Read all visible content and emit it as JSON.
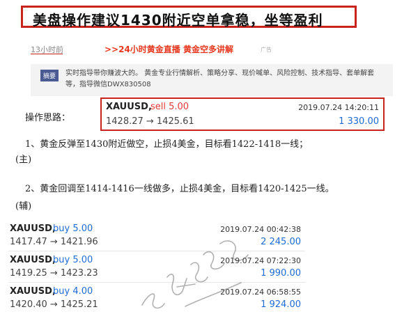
{
  "headline": "美盘操作建议1430附近空单拿稳，坐等盈利",
  "meta": {
    "time_ago": "13小时前",
    "promo_link": ">>24小时黄金直播 黄金空多讲解",
    "ad_tag": "广告"
  },
  "summary": {
    "badge": "摘要",
    "text": "实时指导带你赚波大的。 黄金专业行情解析、策略分享、现价喊单、风险控制、技术指导、套单解套等，指导微信DWX830508"
  },
  "strategy": {
    "title": "操作思路：",
    "item1_line1": "1、黄金反弹至1430附近做空，止损4美金，目标看1422-1418一线；",
    "item1_line2": "(主)",
    "item2_line1": "2、黄金回调至1414-1416一线做多，止损4美金，目标看1420-1425一线。",
    "item2_line2": "(辅)"
  },
  "main_trade": {
    "symbol": "XAUUSD,",
    "side": "sell 5.00",
    "datetime": "2019.07.24 14:20:11",
    "prices": "1428.27 → 1425.61",
    "profit": "1 330.00"
  },
  "trades": [
    {
      "symbol": "XAUUSD,",
      "side": "buy 5.00",
      "datetime": "2019.07.24 00:42:38",
      "prices": "1417.47 → 1421.96",
      "profit": "2 245.00"
    },
    {
      "symbol": "XAUUSD,",
      "side": "buy 5.00",
      "datetime": "2019.07.24 07:22:30",
      "prices": "1419.25 → 1423.23",
      "profit": "1 990.00"
    },
    {
      "symbol": "XAUUSD,",
      "side": "buy 4.00",
      "datetime": "2019.07.24 06:58:55",
      "prices": "1420.40 → 1425.21",
      "profit": "1 924.00"
    }
  ],
  "colors": {
    "headline_border": "#c8231c",
    "sell": "#e53935",
    "buy": "#1e6bd6",
    "promo": "#e8371e"
  }
}
